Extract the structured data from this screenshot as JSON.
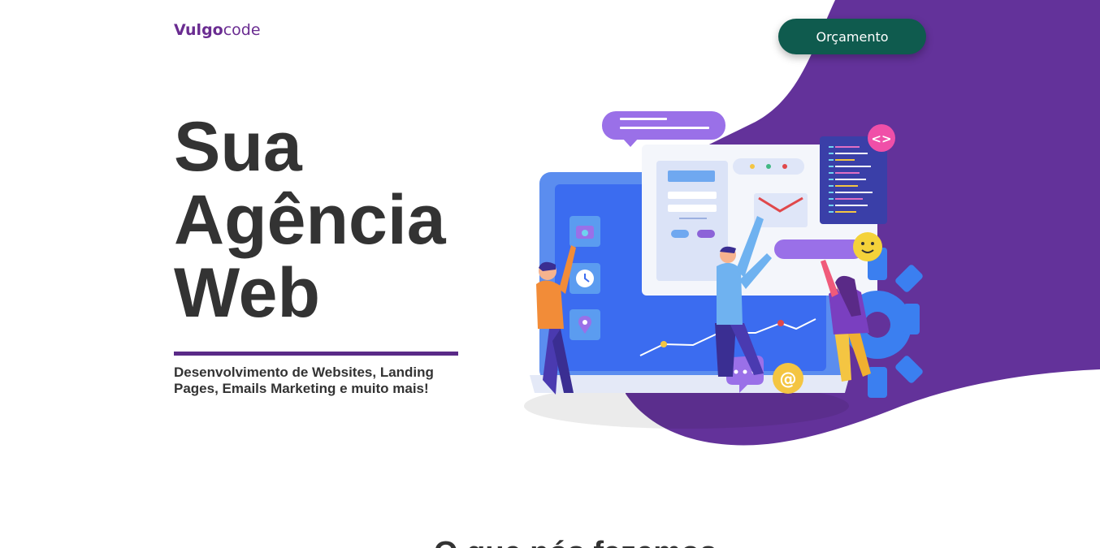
{
  "header": {
    "logo_bold": "Vulgo",
    "logo_light": "code",
    "cta_label": "Orçamento"
  },
  "hero": {
    "title_line1": "Sua",
    "title_line2": "Agência",
    "title_line3": "Web",
    "subtitle": "Desenvolvimento de Websites, Landing Pages, Emails Marketing e muito mais!",
    "code_badge": "<>",
    "at_badge": "@"
  },
  "next_section": {
    "heading_partial": "O que nós fazemos"
  },
  "colors": {
    "brand_purple": "#6a2c91",
    "blob_purple": "#63329a",
    "cta_green": "#0f5b4e",
    "text_dark": "#333333"
  }
}
